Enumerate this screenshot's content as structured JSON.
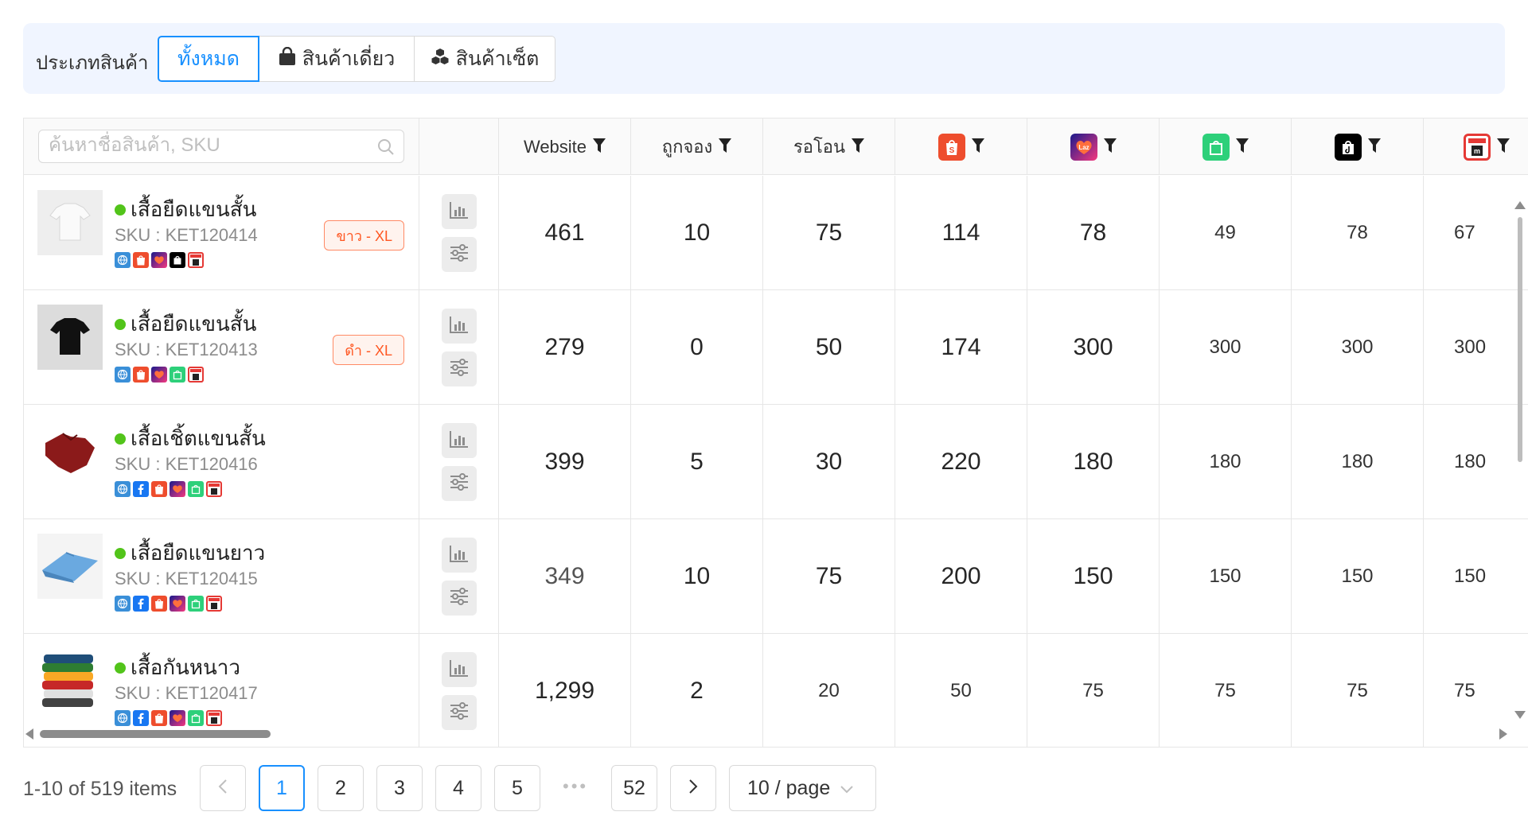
{
  "colors": {
    "accent": "#1890ff",
    "filter_bg": "#f0f5ff",
    "status_active": "#52c41a",
    "variant_text": "#ff5722",
    "shopee": "#ee4d2d",
    "lazada": "#1a1a8c",
    "line_shopping": "#22c55e",
    "tiktok": "#000000",
    "makro": "#e53935"
  },
  "filter": {
    "label": "ประเภทสินค้า",
    "options": [
      {
        "label": "ทั้งหมด",
        "icon": "",
        "active": true
      },
      {
        "label": "สินค้าเดี่ยว",
        "icon": "shopping-bag-icon",
        "active": false
      },
      {
        "label": "สินค้าเซ็ต",
        "icon": "cubes-icon",
        "active": false
      }
    ]
  },
  "search": {
    "placeholder": "ค้นหาชื่อสินค้า, SKU",
    "value": ""
  },
  "columns": {
    "website": "Website",
    "reserved": "ถูกจอง",
    "pending_transfer": "รอโอน",
    "channels": [
      "shopee-icon",
      "lazada-icon",
      "line-shopping-icon",
      "tiktok-shop-icon",
      "makro-icon"
    ]
  },
  "products": [
    {
      "name": "เสื้อยืดแขนสั้น",
      "sku": "SKU : KET120414",
      "variant": "ขาว - XL",
      "thumb": "white-tshirt",
      "channel_icons": [
        "website-icon",
        "shopee-icon",
        "lazada-icon",
        "tiktok-shop-icon",
        "makro-icon"
      ],
      "website": "461",
      "reserved": "10",
      "pending": "75",
      "shopee": "114",
      "lazada": "78",
      "line": "49",
      "tiktok": "78",
      "makro": "67"
    },
    {
      "name": "เสื้อยืดแขนสั้น",
      "sku": "SKU : KET120413",
      "variant": "ดำ - XL",
      "thumb": "black-tshirt",
      "channel_icons": [
        "website-icon",
        "shopee-icon",
        "lazada-icon",
        "line-shopping-icon",
        "makro-icon"
      ],
      "website": "279",
      "reserved": "0",
      "pending": "50",
      "shopee": "174",
      "lazada": "300",
      "line": "300",
      "tiktok": "300",
      "makro": "300"
    },
    {
      "name": "เสื้อเชิ้ตแขนสั้น",
      "sku": "SKU : KET120416",
      "variant": "",
      "thumb": "red-shirt",
      "channel_icons": [
        "website-icon",
        "facebook-icon",
        "shopee-icon",
        "lazada-icon",
        "line-shopping-icon",
        "makro-icon"
      ],
      "website": "399",
      "reserved": "5",
      "pending": "30",
      "shopee": "220",
      "lazada": "180",
      "line": "180",
      "tiktok": "180",
      "makro": "180"
    },
    {
      "name": "เสื้อยืดแขนยาว",
      "sku": "SKU : KET120415",
      "variant": "",
      "thumb": "blue-longsleeve",
      "channel_icons": [
        "website-icon",
        "facebook-icon",
        "shopee-icon",
        "lazada-icon",
        "line-shopping-icon",
        "makro-icon"
      ],
      "website": "349",
      "reserved": "10",
      "pending": "75",
      "shopee": "200",
      "lazada": "150",
      "line": "150",
      "tiktok": "150",
      "makro": "150"
    },
    {
      "name": "เสื้อกันหนาว",
      "sku": "SKU : KET120417",
      "variant": "",
      "thumb": "sweater-stack",
      "channel_icons": [
        "website-icon",
        "facebook-icon",
        "shopee-icon",
        "lazada-icon",
        "line-shopping-icon",
        "makro-icon"
      ],
      "website": "1,299",
      "reserved": "2",
      "pending": "20",
      "shopee": "50",
      "lazada": "75",
      "line": "75",
      "tiktok": "75",
      "makro": "75"
    }
  ],
  "pagination": {
    "total_text": "1-10 of 519 items",
    "pages": [
      "1",
      "2",
      "3",
      "4",
      "5"
    ],
    "current": "1",
    "ellipsis": "•••",
    "last": "52",
    "page_size": "10 / page"
  }
}
